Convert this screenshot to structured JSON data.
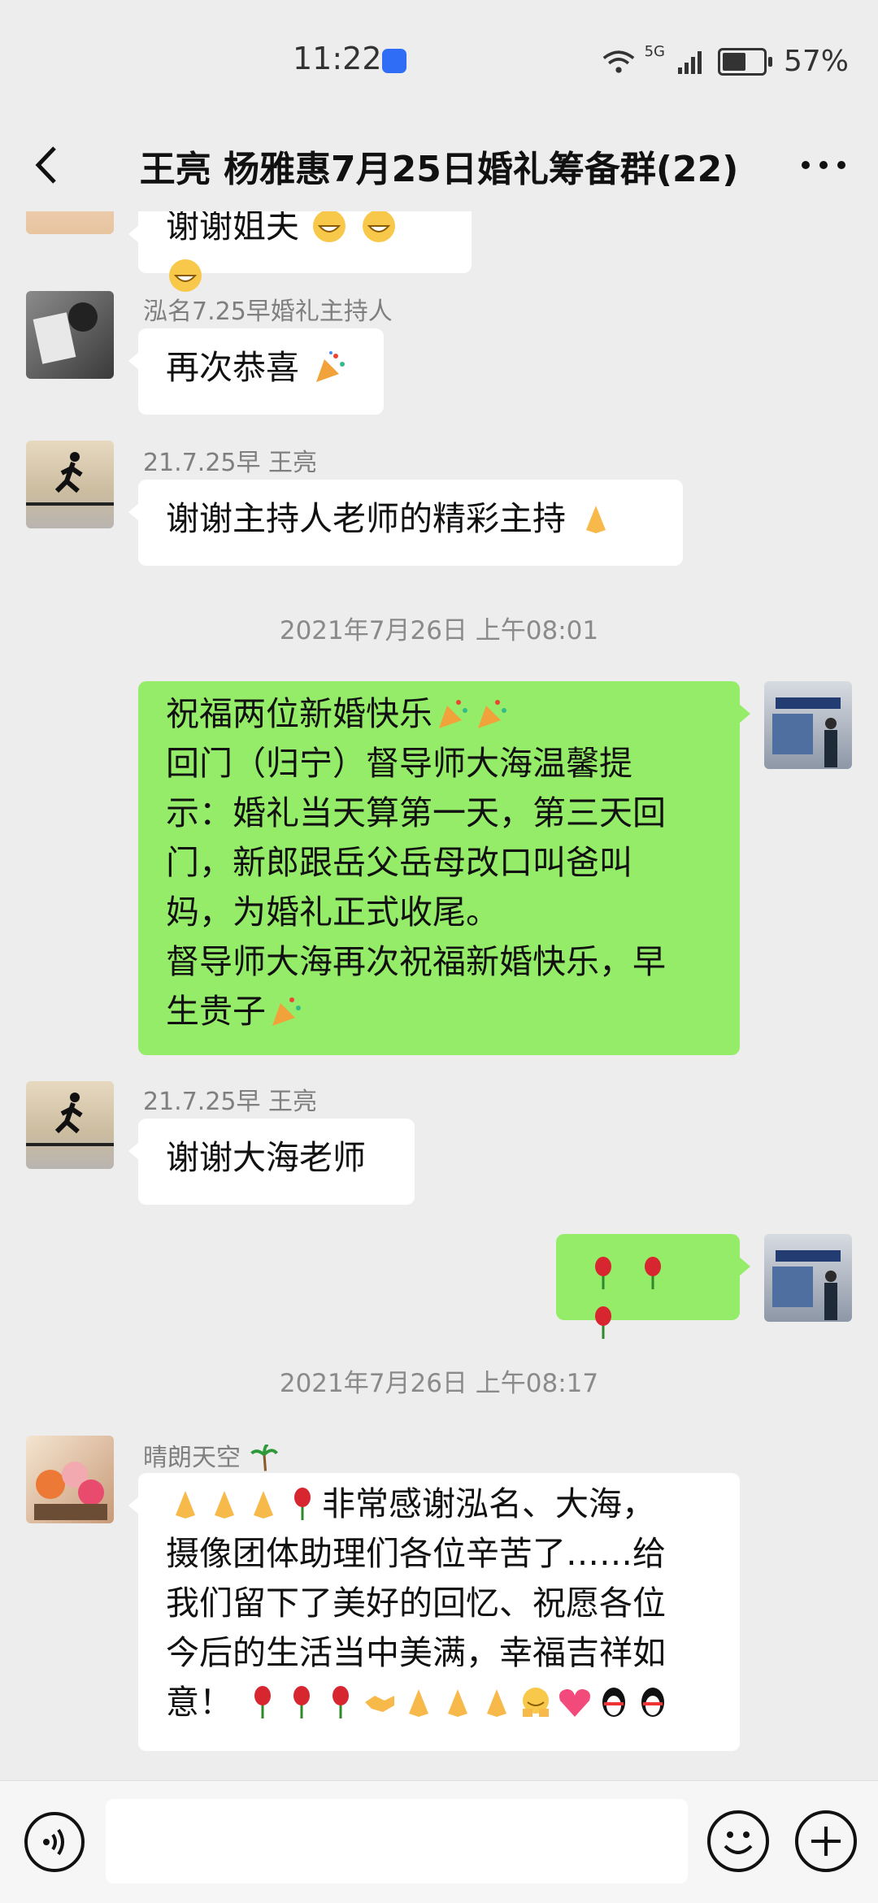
{
  "status_bar": {
    "time": "11:22",
    "network": "5G",
    "battery_percent": "57%",
    "battery_level": 0.57
  },
  "header": {
    "title": "王亮 杨雅惠7月25日婚礼筹备群(22)",
    "back_icon": "chevron-left-icon",
    "more_icon": "more-dots-icon"
  },
  "messages": [
    {
      "type": "partial",
      "text": "谢谢姐夫"
    },
    {
      "type": "received",
      "sender": "泓名7.25早婚礼主持人",
      "text": "再次恭喜"
    },
    {
      "type": "received",
      "sender": "21.7.25早 王亮",
      "text": "谢谢主持人老师的精彩主持"
    },
    {
      "type": "timestamp",
      "text": "2021年7月26日 上午08:01"
    },
    {
      "type": "sent",
      "lines": [
        "祝福两位新婚快乐",
        "回门（归宁）督导师大海温馨提",
        "示：婚礼当天算第一天，第三天回",
        "门，新郎跟岳父岳母改口叫爸叫",
        "妈，为婚礼正式收尾。",
        "督导师大海再次祝福新婚快乐，早",
        "生贵子"
      ]
    },
    {
      "type": "received",
      "sender": "21.7.25早 王亮",
      "text": "谢谢大海老师"
    },
    {
      "type": "sent",
      "text": ""
    },
    {
      "type": "timestamp",
      "text": "2021年7月26日 上午08:17"
    },
    {
      "type": "received",
      "sender": "晴朗天空",
      "lines": [
        "非常感谢泓名、大海，",
        "摄像团体助理们各位辛苦了……给",
        "我们留下了美好的回忆、祝愿各位",
        "今后的生活当中美满，幸福吉祥如",
        "意！"
      ]
    }
  ],
  "input_bar": {
    "voice_icon": "voice-icon",
    "emoji_icon": "smiley-icon",
    "plus_icon": "plus-icon",
    "placeholder": ""
  },
  "colors": {
    "background": "#ededed",
    "sent_bubble": "#95ec69",
    "received_bubble": "#ffffff"
  }
}
